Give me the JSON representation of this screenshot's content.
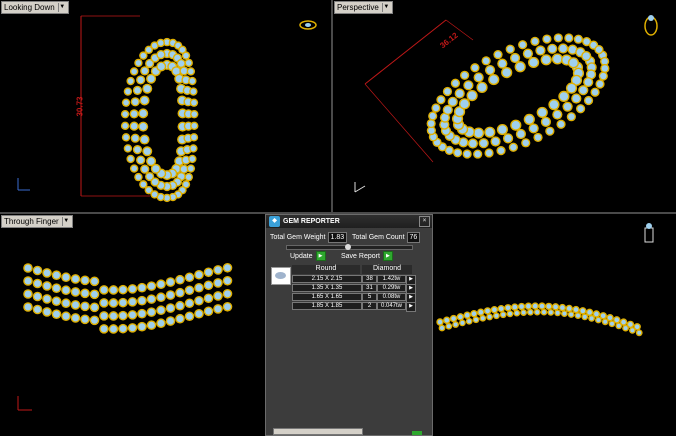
{
  "viewports": {
    "top_left": {
      "label": "Looking Down",
      "dimension": "30.73"
    },
    "top_right": {
      "label": "Perspective",
      "dimension": "36.12"
    },
    "bottom_left": {
      "label": "Through Finger"
    },
    "bottom_right": {
      "label": ""
    }
  },
  "gem_reporter": {
    "title": "GEM REPORTER",
    "total_weight_label": "Total Gem Weight",
    "total_weight_value": "1.83",
    "total_count_label": "Total Gem Count",
    "total_count_value": "76",
    "update_label": "Update",
    "save_label": "Save Report",
    "shape_header": "Round",
    "material_header": "Diamond",
    "rows": [
      {
        "size": "2.15 X 2.15",
        "count": "38",
        "weight": "1.42tw"
      },
      {
        "size": "1.35 X 1.35",
        "count": "31",
        "weight": "0.29tw"
      },
      {
        "size": "1.65 X 1.65",
        "count": "5",
        "weight": "0.08tw"
      },
      {
        "size": "1.85 X 1.85",
        "count": "2",
        "weight": "0.047tw"
      }
    ]
  },
  "colors": {
    "gold": "#e0b000",
    "gem": "#9fd0ee",
    "dim_line": "#c01818",
    "background": "#000000"
  }
}
